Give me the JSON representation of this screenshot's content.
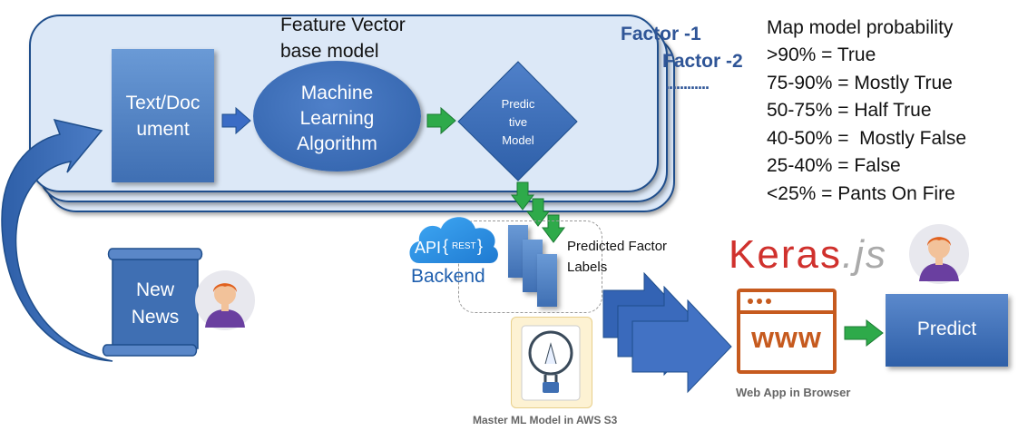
{
  "feature_vector": {
    "line1": "Feature Vector",
    "line2": "base model"
  },
  "factors": {
    "factor1": "Factor -1",
    "factor2": "Factor -2",
    "more": "............"
  },
  "text_document": {
    "line1": "Text/Doc",
    "line2": "ument"
  },
  "ml_algorithm": {
    "line1": "Machine",
    "line2": "Learning",
    "line3": "Algorithm"
  },
  "predictive_model": {
    "line1": "Predic",
    "line2": "tive",
    "line3": "Model"
  },
  "map_probability": {
    "title": "Map model probability",
    "rules": [
      ">90% = True",
      "75-90% = Mostly True",
      "50-75% = Half True",
      "40-50% =  Mostly False",
      "25-40% = False",
      "<25% = Pants On Fire"
    ]
  },
  "new_news": {
    "line1": "New",
    "line2": "News"
  },
  "api": {
    "label": "API",
    "rest": "REST",
    "backend": "Backend"
  },
  "predicted_labels": {
    "line1": "Predicted Factor",
    "line2": "Labels"
  },
  "master_model": {
    "caption": "Master ML Model in AWS S3"
  },
  "keras": {
    "logo_a": "Keras",
    "logo_b": ".js"
  },
  "webapp": {
    "www": "www",
    "caption": "Web App in Browser"
  },
  "predict": {
    "label": "Predict"
  },
  "colors": {
    "dark_blue": "#1f4e8c",
    "panel": "#dce8f7",
    "green": "#2eaa4a",
    "keras_red": "#d0312d",
    "browser_orange": "#c65a1e"
  }
}
